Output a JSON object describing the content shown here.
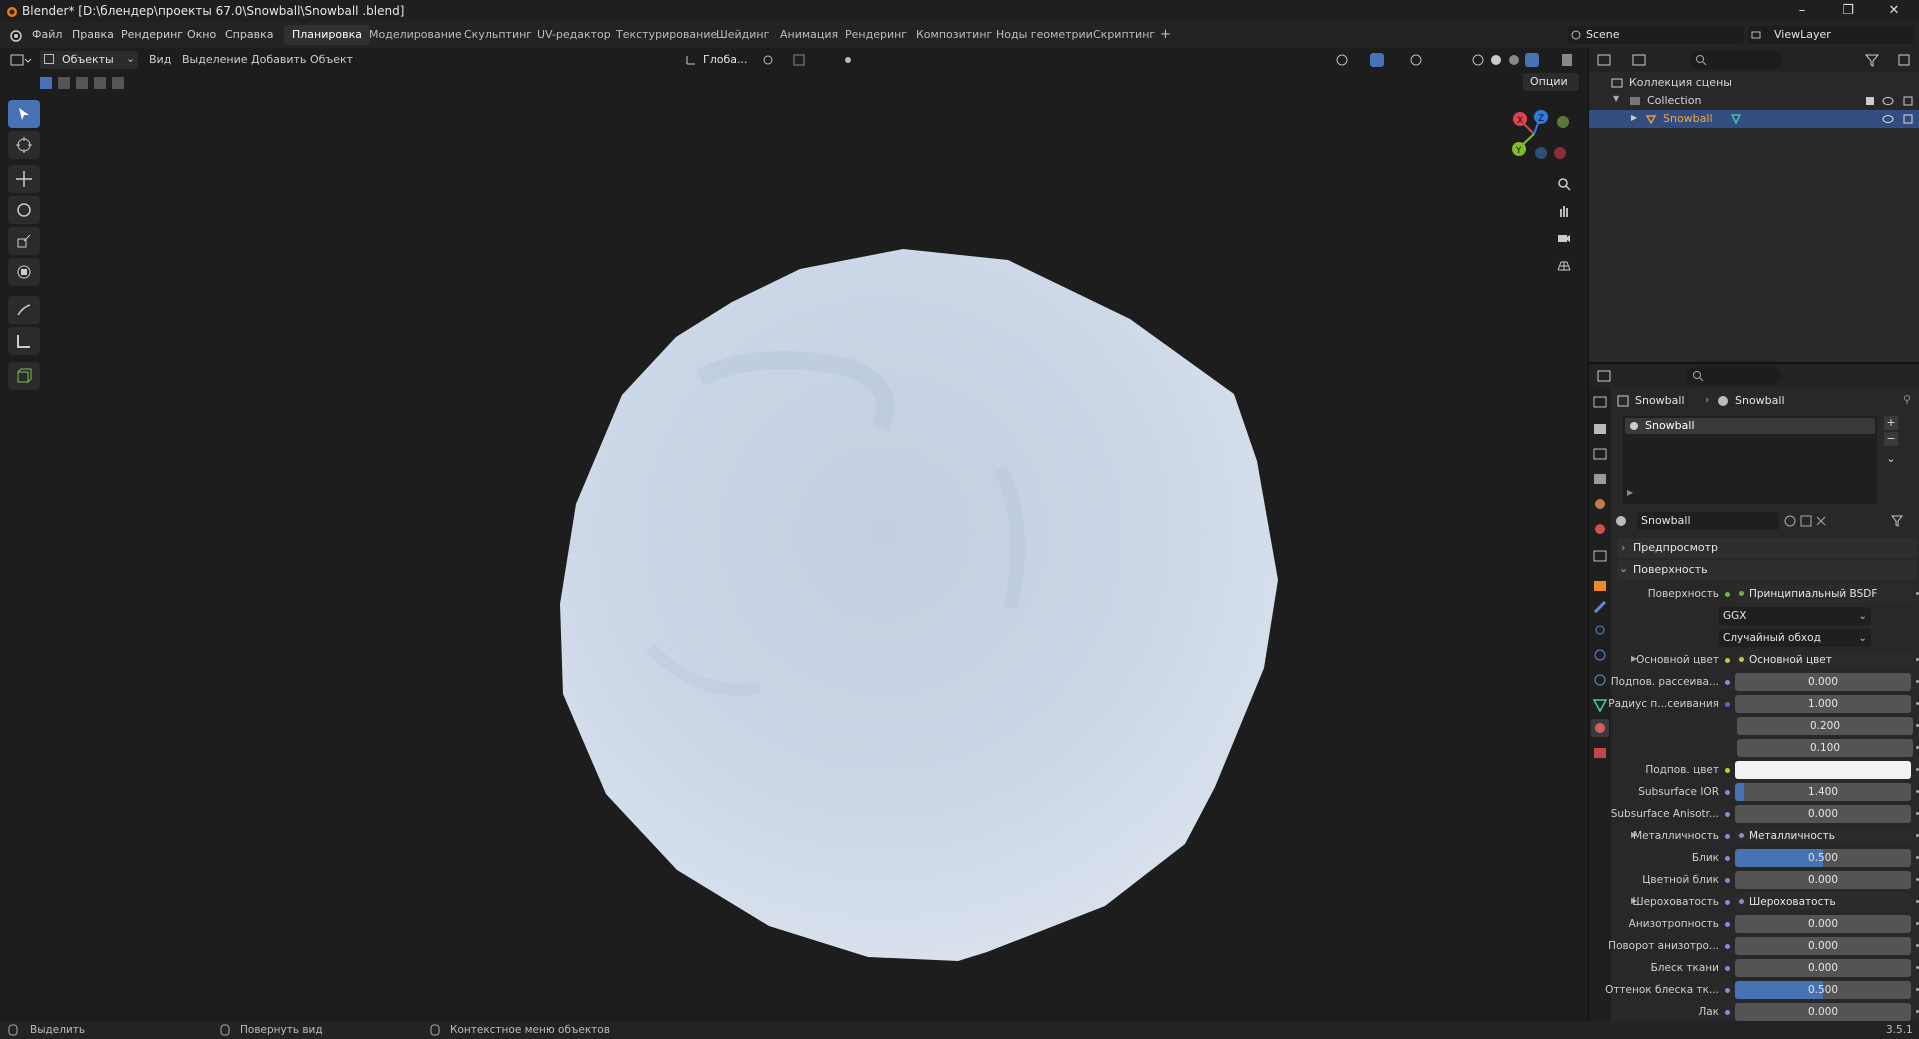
{
  "window": {
    "title": "Blender* [D:\\блендер\\проекты 67.0\\Snowball\\Snowball .blend]",
    "minimize": "–",
    "maximize": "❐",
    "close": "✕"
  },
  "menu": {
    "items": [
      "Файл",
      "Правка",
      "Рендеринг",
      "Окно",
      "Справка"
    ],
    "workspaces": [
      "Планировка",
      "Моделирование",
      "Скульптинг",
      "UV-редактор",
      "Текстурирование",
      "Шейдинг",
      "Анимация",
      "Рендеринг",
      "Композитинг",
      "Ноды геометрии",
      "Скриптинг",
      "+"
    ],
    "active_workspace": "Планировка",
    "scene": "Scene",
    "view_layer": "ViewLayer"
  },
  "viewport": {
    "mode": "Объекты",
    "menus": [
      "Вид",
      "Выделение",
      "Добавить",
      "Объект"
    ],
    "transform": "Глоба...",
    "options": "Опции",
    "gizmo": {
      "x": "X",
      "y": "Y",
      "z": "Z"
    }
  },
  "outliner": {
    "root": "Коллекция сцены",
    "collection": "Collection",
    "object": "Snowball"
  },
  "properties": {
    "breadcrumb": [
      "Snowball",
      "Snowball"
    ],
    "slot": "Snowball",
    "material_name": "Snowball",
    "sections": {
      "preview": "Предпросмотр",
      "surface": "Поверхность"
    },
    "rows": [
      {
        "label": "Поверхность",
        "value": "Принципиальный BSDF",
        "kind": "link",
        "sock": "#6cb34a"
      },
      {
        "label": "",
        "value": "GGX",
        "kind": "dropdown"
      },
      {
        "label": "",
        "value": "Случайный обход",
        "kind": "dropdown"
      },
      {
        "label": "Основной цвет",
        "value": "Основной цвет",
        "kind": "link",
        "sock": "#c8c83c",
        "expand": true
      },
      {
        "label": "Подпов. рассеива...",
        "value": "0.000",
        "kind": "num",
        "sock": "#8a8ad0"
      },
      {
        "label": "Радиус п...сеивания",
        "value": "1.000",
        "kind": "num",
        "sock": "#6464c8"
      },
      {
        "label": "",
        "value": "0.200",
        "kind": "num"
      },
      {
        "label": "",
        "value": "0.100",
        "kind": "num"
      },
      {
        "label": "Подпов. цвет",
        "value": "",
        "kind": "color",
        "sock": "#c8c83c"
      },
      {
        "label": "Subsurface IOR",
        "value": "1.400",
        "kind": "num",
        "sock": "#8a8ad0",
        "fill": 0.05
      },
      {
        "label": "Subsurface Anisotr...",
        "value": "0.000",
        "kind": "num",
        "sock": "#8a8ad0"
      },
      {
        "label": "Металличность",
        "value": "Металличность",
        "kind": "link",
        "sock": "#8a8ad0",
        "expand": true
      },
      {
        "label": "Блик",
        "value": "0.500",
        "kind": "num",
        "sock": "#8a8ad0",
        "fill": 0.5
      },
      {
        "label": "Цветной блик",
        "value": "0.000",
        "kind": "num",
        "sock": "#8a8ad0"
      },
      {
        "label": "Шероховатость",
        "value": "Шероховатость",
        "kind": "link",
        "sock": "#8a8ad0",
        "expand": true
      },
      {
        "label": "Анизотропность",
        "value": "0.000",
        "kind": "num",
        "sock": "#8a8ad0"
      },
      {
        "label": "Поворот анизотро...",
        "value": "0.000",
        "kind": "num",
        "sock": "#8a8ad0"
      },
      {
        "label": "Блеск ткани",
        "value": "0.000",
        "kind": "num",
        "sock": "#8a8ad0"
      },
      {
        "label": "Оттенок блеска тк...",
        "value": "0.500",
        "kind": "num",
        "sock": "#8a8ad0",
        "fill": 0.5
      },
      {
        "label": "Лак",
        "value": "0.000",
        "kind": "num",
        "sock": "#8a8ad0"
      }
    ]
  },
  "statusbar": {
    "select": "Выделить",
    "rotate": "Повернуть вид",
    "context": "Контекстное меню объектов",
    "version": "3.5.1"
  },
  "colors": {
    "accent": "#4772b3",
    "selected_row": "#334d80",
    "background": "#1d1d1d",
    "snowball": "#c9d6e6"
  }
}
